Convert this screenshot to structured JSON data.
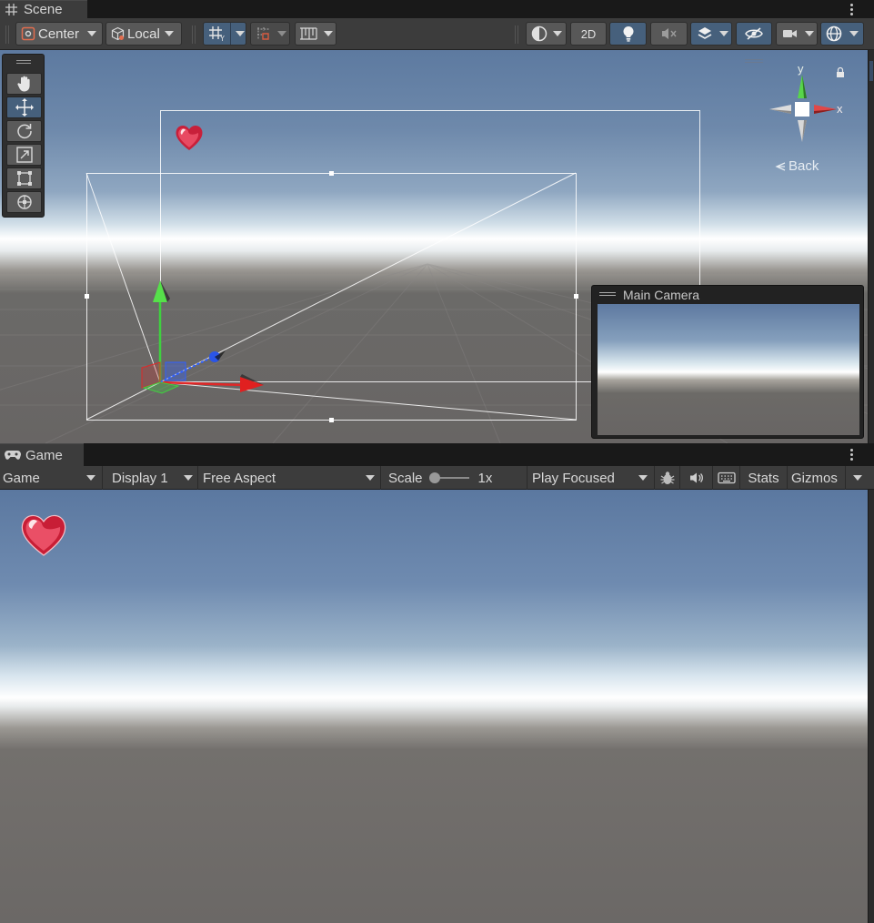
{
  "scene": {
    "tab_label": "Scene",
    "toolbar": {
      "pivot_mode": "Center",
      "pivot_rotation": "Local",
      "mode_2d": "2D"
    },
    "gizmo": {
      "axis_y": "y",
      "axis_x": "x",
      "view_label": "Back"
    },
    "camera_preview": {
      "title": "Main Camera"
    }
  },
  "game": {
    "tab_label": "Game",
    "toolbar": {
      "view_type": "Game",
      "display": "Display 1",
      "aspect": "Free Aspect",
      "scale_label": "Scale",
      "scale_value": "1x",
      "play_mode": "Play Focused",
      "stats": "Stats",
      "gizmos": "Gizmos"
    }
  },
  "colors": {
    "panel_bg": "#3c3c3c",
    "button_bg": "#585858",
    "active_blue": "#46607c",
    "axis_x": "#e03030",
    "axis_y": "#3fc03f",
    "axis_z": "#2a63e0"
  }
}
